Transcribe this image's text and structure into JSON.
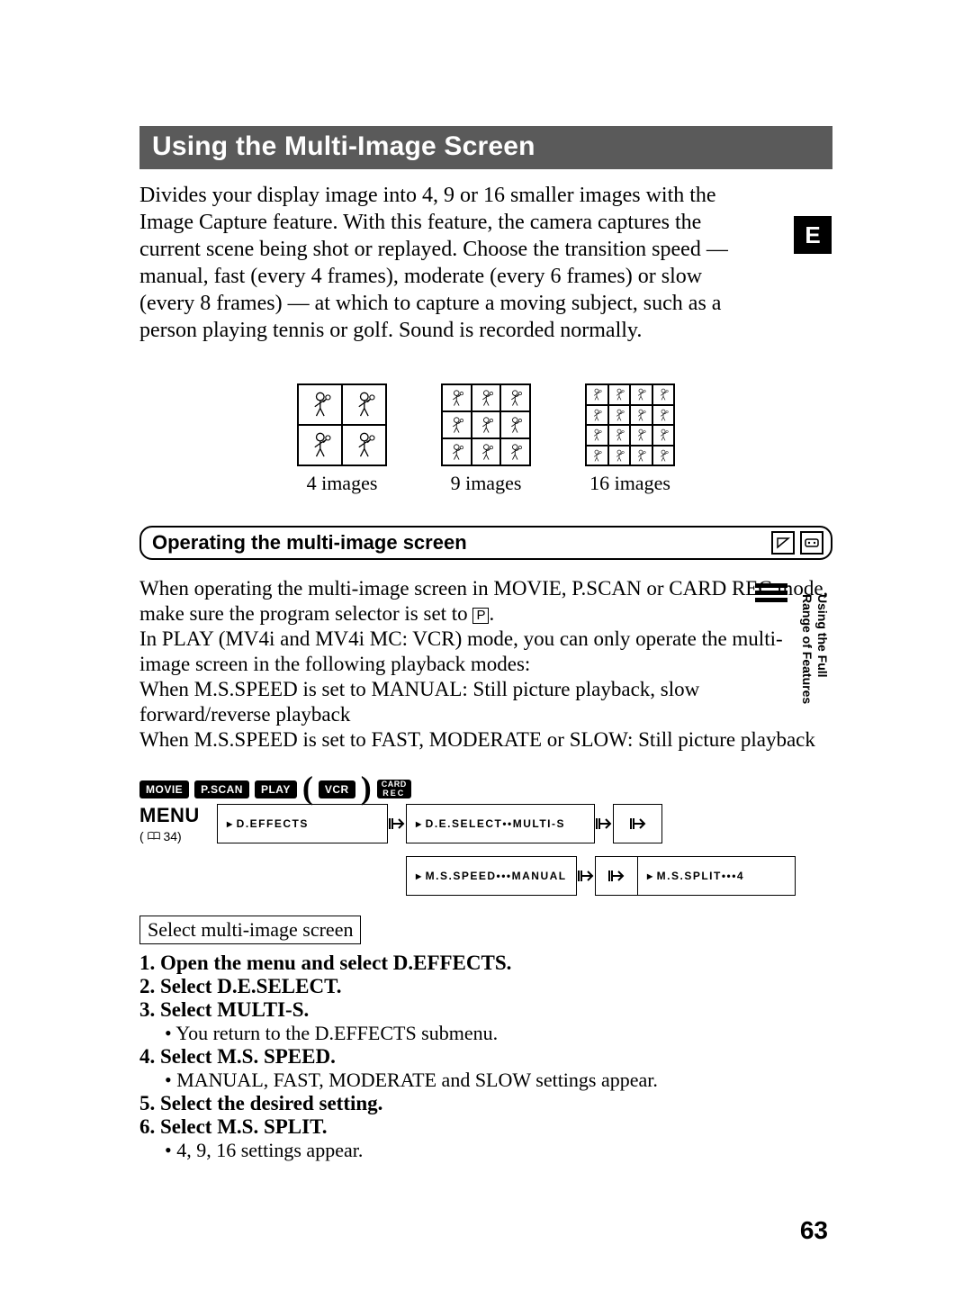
{
  "header": {
    "title": "Using the Multi-Image Screen"
  },
  "intro": "Divides your display image into 4, 9 or 16 smaller images with the Image Capture feature. With this feature, the camera captures the current scene being shot or replayed. Choose the transition speed — manual, fast (every 4 frames), moderate (every 6 frames) or slow (every 8 frames) — at which to capture a moving subject, such as a person playing tennis or golf. Sound is recorded normally.",
  "lang_badge": "E",
  "side_tab": {
    "line1": "Using the Full",
    "line2": "Range of Features"
  },
  "grids": {
    "c4": "4 images",
    "c9": "9 images",
    "c16": "16 images"
  },
  "op_section": {
    "title": "Operating the multi-image screen"
  },
  "body": {
    "p1a": "When operating the multi-image screen in MOVIE, P.SCAN or CARD REC mode, make sure the program selector is set to ",
    "p1b": ".",
    "psym": "P",
    "p2": "In PLAY (MV4i and MV4i MC: VCR) mode, you can only operate the multi-image screen in the following playback modes:",
    "p3": "When M.S.SPEED is set to MANUAL: Still picture playback, slow forward/reverse playback",
    "p4": "When M.S.SPEED is set to FAST, MODERATE or SLOW: Still picture playback"
  },
  "modes": {
    "movie": "MOVIE",
    "pscan": "P.SCAN",
    "play": "PLAY",
    "vcr": "VCR",
    "card_top": "CARD",
    "card_bot": "REC"
  },
  "menu": {
    "label": "MENU",
    "ref_prefix": "( ",
    "ref_num": "34)",
    "step1": "D.EFFECTS",
    "step2": "D.E.SELECT••MULTI-S",
    "step3": "M.S.SPEED•••MANUAL",
    "step4": "M.S.SPLIT•••4"
  },
  "select_label": "Select multi-image screen",
  "steps": {
    "s1": "1. Open the menu and select D.EFFECTS.",
    "s2": "2. Select D.E.SELECT.",
    "s3": "3. Select MULTI-S.",
    "s3b": "• You return to the D.EFFECTS submenu.",
    "s4": "4. Select M.S. SPEED.",
    "s4b": "• MANUAL, FAST, MODERATE and SLOW settings appear.",
    "s5": "5. Select the desired setting.",
    "s6": "6. Select M.S. SPLIT.",
    "s6b": "• 4, 9, 16 settings appear."
  },
  "page_number": "63"
}
